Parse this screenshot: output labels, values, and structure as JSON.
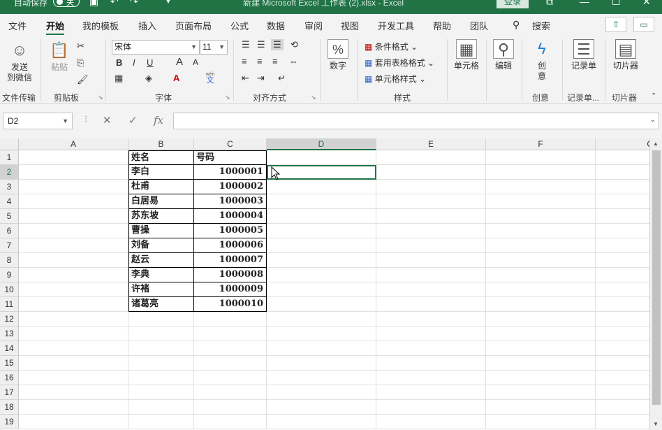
{
  "titlebar": {
    "autosave_label": "自动保存",
    "toggle_label": "关",
    "title": "新建 Microsoft Excel 工作表 (2).xlsx  -  Excel",
    "login": "登录",
    "icons": [
      "save-icon",
      "undo-icon",
      "redo-icon",
      "customize-icon",
      "ribbon-display-icon",
      "minimize-icon",
      "restore-icon",
      "close-icon"
    ]
  },
  "tabs": [
    "文件",
    "开始",
    "我的模板",
    "插入",
    "页面布局",
    "公式",
    "数据",
    "审阅",
    "视图",
    "开发工具",
    "帮助",
    "团队"
  ],
  "active_tab": "开始",
  "search_label": "搜索",
  "ribbon": {
    "send_wechat": "发送\n到微信",
    "paste": "粘贴",
    "font_name": "宋体",
    "font_size": "11",
    "bold": "B",
    "italic": "I",
    "underline": "U",
    "grow_font": "A",
    "shrink_font": "A",
    "wen_top": "wén",
    "wen_char": "文",
    "percent": "%",
    "number": "数字",
    "cond_format": "条件格式",
    "table_format": "套用表格格式",
    "cell_style": "单元格样式",
    "cells": "单元格",
    "edit": "编辑",
    "create": "创\n意",
    "record": "记录单",
    "slicer": "切片器",
    "groups": {
      "file_transfer": "文件传输",
      "clipboard": "剪贴板",
      "font": "字体",
      "align": "对齐方式",
      "styles": "样式",
      "creative": "创意",
      "record_short": "记录单...",
      "slicer": "切片器"
    }
  },
  "formula_bar": {
    "name_box": "D2",
    "formula": ""
  },
  "columns": [
    "A",
    "B",
    "C",
    "D",
    "E",
    "F",
    "G"
  ],
  "rows": [
    "1",
    "2",
    "3",
    "4",
    "5",
    "6",
    "7",
    "8",
    "9",
    "10",
    "11",
    "12",
    "13",
    "14",
    "15",
    "16",
    "17",
    "18",
    "19"
  ],
  "sheet": {
    "header": [
      "姓名",
      "号码"
    ],
    "data": [
      [
        "李白",
        "1000001"
      ],
      [
        "杜甫",
        "1000002"
      ],
      [
        "白居易",
        "1000003"
      ],
      [
        "苏东坡",
        "1000004"
      ],
      [
        "曹操",
        "1000005"
      ],
      [
        "刘备",
        "1000006"
      ],
      [
        "赵云",
        "1000007"
      ],
      [
        "李典",
        "1000008"
      ],
      [
        "许褚",
        "1000009"
      ],
      [
        "诸葛亮",
        "1000010"
      ]
    ]
  },
  "colors": {
    "accent": "#217346"
  }
}
